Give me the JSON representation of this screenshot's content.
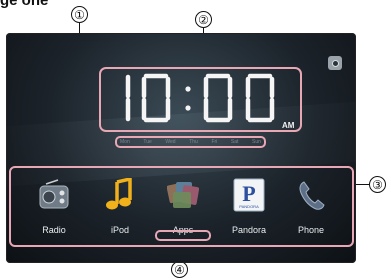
{
  "heading": "ge one",
  "callouts": [
    "①",
    "②",
    "③",
    "④"
  ],
  "clock": {
    "time": "10:00",
    "ampm": "AM"
  },
  "days": [
    "Mon",
    "Tue",
    "Wed",
    "Thu",
    "Fri",
    "Sat",
    "Sun"
  ],
  "dock": {
    "items": [
      {
        "label": "Radio",
        "icon": "radio-icon"
      },
      {
        "label": "iPod",
        "icon": "music-note-icon"
      },
      {
        "label": "Apps",
        "icon": "apps-icon"
      },
      {
        "label": "Pandora",
        "icon": "pandora-icon",
        "glyph": "P",
        "sub": "PANDORA"
      },
      {
        "label": "Phone",
        "icon": "phone-icon"
      }
    ]
  },
  "colors": {
    "highlight": "#e8a7b4",
    "screen_bg": "#1b2229",
    "digits": "#f5f5f5"
  }
}
